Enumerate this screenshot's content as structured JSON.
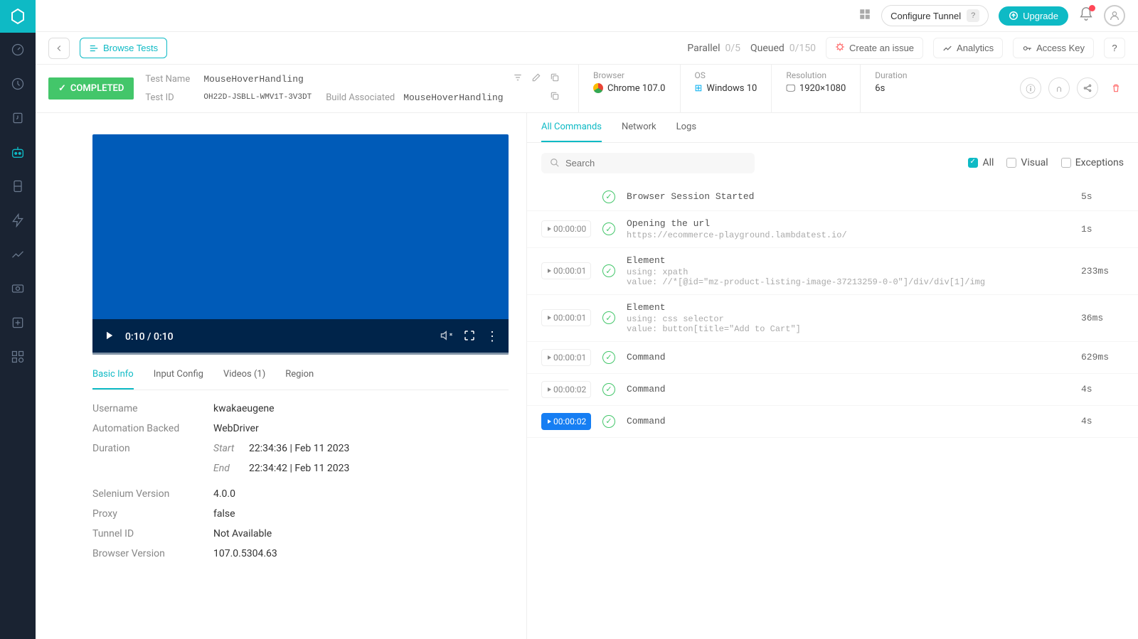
{
  "topbar": {
    "tunnel": "Configure Tunnel",
    "tunnel_q": "?",
    "upgrade": "Upgrade"
  },
  "subheader": {
    "browse": "Browse Tests",
    "parallel_label": "Parallel",
    "parallel_value": "0/5",
    "queued_label": "Queued",
    "queued_value": "0/150",
    "create_issue": "Create an issue",
    "analytics": "Analytics",
    "access_key": "Access Key",
    "help": "?"
  },
  "status": "COMPLETED",
  "meta": {
    "test_name_label": "Test Name",
    "test_name": "MouseHoverHandling",
    "test_id_label": "Test ID",
    "test_id": "OH22D-JSBLL-WMV1T-3V3DT",
    "build_assoc_label": "Build Associated",
    "build_assoc": "MouseHoverHandling",
    "browser_label": "Browser",
    "browser_value": "Chrome 107.0",
    "os_label": "OS",
    "os_value": "Windows 10",
    "resolution_label": "Resolution",
    "resolution_value": "1920×1080",
    "duration_label": "Duration",
    "duration_value": "6s"
  },
  "video": {
    "time": "0:10 / 0:10"
  },
  "tabs_lower": {
    "basic": "Basic Info",
    "input": "Input Config",
    "videos": "Videos (1)",
    "region": "Region"
  },
  "info": {
    "username_label": "Username",
    "username": "kwakaeugene",
    "backed_label": "Automation Backed",
    "backed": "WebDriver",
    "duration_label": "Duration",
    "start_label": "Start",
    "start": "22:34:36 | Feb 11 2023",
    "end_label": "End",
    "end": "22:34:42 | Feb 11 2023",
    "selenium_label": "Selenium Version",
    "selenium": "4.0.0",
    "proxy_label": "Proxy",
    "proxy": "false",
    "tunnel_label": "Tunnel ID",
    "tunnel": "Not Available",
    "bver_label": "Browser Version",
    "bver": "107.0.5304.63"
  },
  "tabs_right": {
    "all": "All Commands",
    "network": "Network",
    "logs": "Logs"
  },
  "search_placeholder": "Search",
  "filters": {
    "all": "All",
    "visual": "Visual",
    "exceptions": "Exceptions"
  },
  "commands": [
    {
      "ts": "",
      "title": "Browser Session Started",
      "sub": "",
      "dur": "5s",
      "active": false
    },
    {
      "ts": "00:00:00",
      "title": "Opening the url",
      "sub": "https://ecommerce-playground.lambdatest.io/",
      "dur": "1s",
      "active": false
    },
    {
      "ts": "00:00:01",
      "title": "Element",
      "sub": "using: xpath\nvalue: //*[@id=\"mz-product-listing-image-37213259-0-0\"]/div/div[1]/img",
      "dur": "233ms",
      "active": false
    },
    {
      "ts": "00:00:01",
      "title": "Element",
      "sub": "using: css selector\nvalue: button[title=\"Add to Cart\"]",
      "dur": "36ms",
      "active": false
    },
    {
      "ts": "00:00:01",
      "title": "Command",
      "sub": "",
      "dur": "629ms",
      "active": false
    },
    {
      "ts": "00:00:02",
      "title": "Command",
      "sub": "",
      "dur": "4s",
      "active": false
    },
    {
      "ts": "00:00:02",
      "title": "Command",
      "sub": "",
      "dur": "4s",
      "active": true
    }
  ]
}
